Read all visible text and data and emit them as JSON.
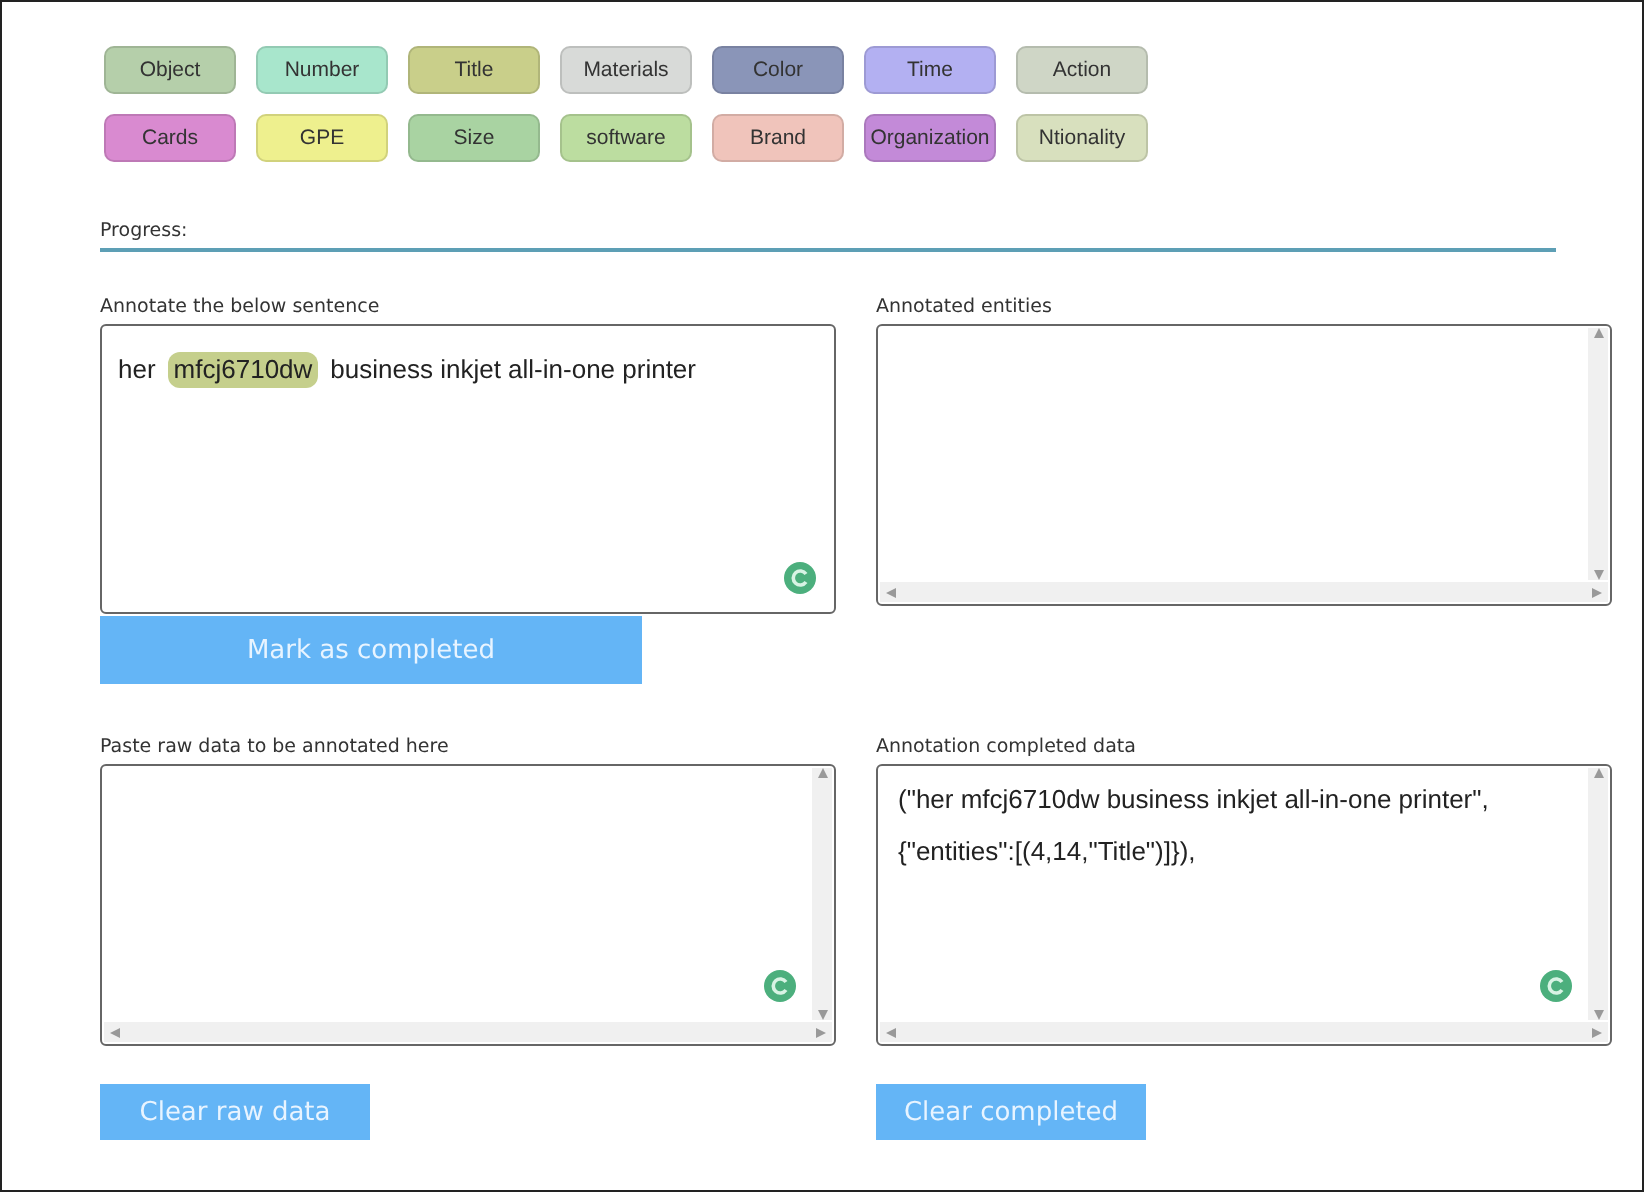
{
  "tags": [
    {
      "label": "Object",
      "color": "#b5cfaa"
    },
    {
      "label": "Number",
      "color": "#a8e6cc"
    },
    {
      "label": "Title",
      "color": "#c9cf8a"
    },
    {
      "label": "Materials",
      "color": "#d8dad8"
    },
    {
      "label": "Color",
      "color": "#8a95b8"
    },
    {
      "label": "Time",
      "color": "#b3b0f2"
    },
    {
      "label": "Action",
      "color": "#cfd6c6"
    },
    {
      "label": "Cards",
      "color": "#d98ad0"
    },
    {
      "label": "GPE",
      "color": "#eef08e"
    },
    {
      "label": "Size",
      "color": "#a9d3a2"
    },
    {
      "label": "software",
      "color": "#bcdda0"
    },
    {
      "label": "Brand",
      "color": "#f0c4bb"
    },
    {
      "label": "Organization",
      "color": "#c38ad8"
    },
    {
      "label": "Ntionality",
      "color": "#d8e0be"
    }
  ],
  "progress": {
    "label": "Progress:"
  },
  "annotate": {
    "label": "Annotate the below sentence",
    "tokens": [
      {
        "text": "her"
      },
      {
        "text": "mfcj6710dw",
        "color": "#c5cf8c"
      },
      {
        "text": "business inkjet all-in-one printer"
      }
    ],
    "button": "Mark as completed"
  },
  "entities": {
    "label": "Annotated entities"
  },
  "raw": {
    "label": "Paste raw data to be annotated here",
    "button": "Clear raw data"
  },
  "completed": {
    "label": "Annotation completed data",
    "lines": [
      "(\"her mfcj6710dw business inkjet all-in-one printer\",",
      "{\"entities\":[(4,14,\"Title\")]}),"
    ],
    "button": "Clear completed"
  }
}
